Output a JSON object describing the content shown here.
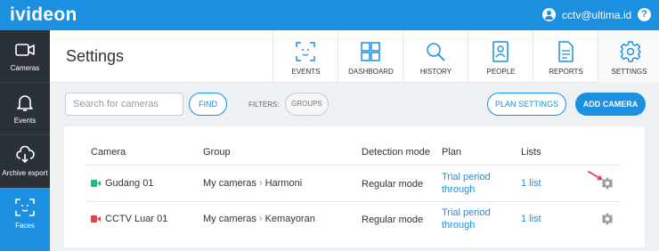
{
  "app": {
    "logo": "ivideon",
    "user_email": "cctv@ultima.id",
    "help": "?"
  },
  "sidebar": {
    "items": [
      {
        "label": "Cameras",
        "icon": "camera-icon"
      },
      {
        "label": "Events",
        "icon": "bell-icon"
      },
      {
        "label": "Archive export",
        "icon": "cloud-download-icon"
      },
      {
        "label": "Faces",
        "icon": "face-scan-icon",
        "active": true
      }
    ]
  },
  "header": {
    "title": "Settings",
    "tabs": [
      {
        "label": "EVENTS",
        "icon": "face-scan-icon"
      },
      {
        "label": "DASHBOARD",
        "icon": "dashboard-icon"
      },
      {
        "label": "HISTORY",
        "icon": "search-icon"
      },
      {
        "label": "PEOPLE",
        "icon": "person-card-icon"
      },
      {
        "label": "REPORTS",
        "icon": "document-icon"
      },
      {
        "label": "SETTINGS",
        "icon": "gear-icon",
        "active": true
      }
    ]
  },
  "toolbar": {
    "search_placeholder": "Search for cameras",
    "find_label": "FIND",
    "filters_label": "FILTERS:",
    "groups_label": "GROUPS",
    "plan_settings_label": "PLAN SETTINGS",
    "add_camera_label": "ADD CAMERA"
  },
  "table": {
    "headers": [
      "Camera",
      "Group",
      "Detection mode",
      "Plan",
      "Lists"
    ],
    "rows": [
      {
        "camera": "Gudang 01",
        "status_color": "#2bb673",
        "group_root": "My cameras",
        "group_sub": "Harmoni",
        "detection_mode": "Regular mode",
        "plan_line1": "Trial period",
        "plan_line2": "through",
        "lists": "1 list"
      },
      {
        "camera": "CCTV Luar 01",
        "status_color": "#e04848",
        "group_root": "My cameras",
        "group_sub": "Kemayoran",
        "detection_mode": "Regular mode",
        "plan_line1": "Trial period",
        "plan_line2": "through",
        "lists": "1 list"
      }
    ],
    "crumb_separator": "›"
  },
  "colors": {
    "accent": "#1b8fe0",
    "sidebar": "#2b3138",
    "arrow": "#e8336e"
  }
}
